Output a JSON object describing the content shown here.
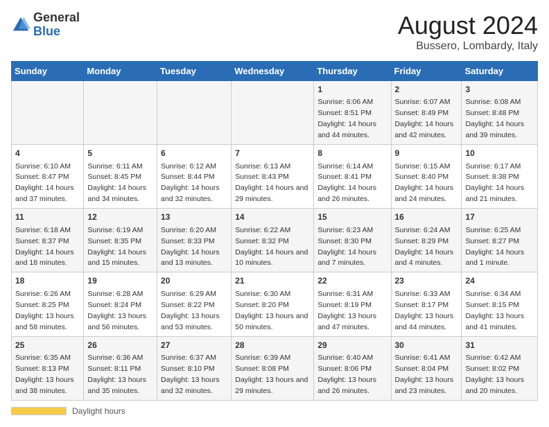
{
  "header": {
    "logo_general": "General",
    "logo_blue": "Blue",
    "main_title": "August 2024",
    "subtitle": "Bussero, Lombardy, Italy"
  },
  "days_of_week": [
    "Sunday",
    "Monday",
    "Tuesday",
    "Wednesday",
    "Thursday",
    "Friday",
    "Saturday"
  ],
  "footer": {
    "daylight_label": "Daylight hours"
  },
  "weeks": [
    [
      {
        "day": "",
        "info": ""
      },
      {
        "day": "",
        "info": ""
      },
      {
        "day": "",
        "info": ""
      },
      {
        "day": "",
        "info": ""
      },
      {
        "day": "1",
        "info": "Sunrise: 6:06 AM\nSunset: 8:51 PM\nDaylight: 14 hours and 44 minutes."
      },
      {
        "day": "2",
        "info": "Sunrise: 6:07 AM\nSunset: 8:49 PM\nDaylight: 14 hours and 42 minutes."
      },
      {
        "day": "3",
        "info": "Sunrise: 6:08 AM\nSunset: 8:48 PM\nDaylight: 14 hours and 39 minutes."
      }
    ],
    [
      {
        "day": "4",
        "info": "Sunrise: 6:10 AM\nSunset: 8:47 PM\nDaylight: 14 hours and 37 minutes."
      },
      {
        "day": "5",
        "info": "Sunrise: 6:11 AM\nSunset: 8:45 PM\nDaylight: 14 hours and 34 minutes."
      },
      {
        "day": "6",
        "info": "Sunrise: 6:12 AM\nSunset: 8:44 PM\nDaylight: 14 hours and 32 minutes."
      },
      {
        "day": "7",
        "info": "Sunrise: 6:13 AM\nSunset: 8:43 PM\nDaylight: 14 hours and 29 minutes."
      },
      {
        "day": "8",
        "info": "Sunrise: 6:14 AM\nSunset: 8:41 PM\nDaylight: 14 hours and 26 minutes."
      },
      {
        "day": "9",
        "info": "Sunrise: 6:15 AM\nSunset: 8:40 PM\nDaylight: 14 hours and 24 minutes."
      },
      {
        "day": "10",
        "info": "Sunrise: 6:17 AM\nSunset: 8:38 PM\nDaylight: 14 hours and 21 minutes."
      }
    ],
    [
      {
        "day": "11",
        "info": "Sunrise: 6:18 AM\nSunset: 8:37 PM\nDaylight: 14 hours and 18 minutes."
      },
      {
        "day": "12",
        "info": "Sunrise: 6:19 AM\nSunset: 8:35 PM\nDaylight: 14 hours and 15 minutes."
      },
      {
        "day": "13",
        "info": "Sunrise: 6:20 AM\nSunset: 8:33 PM\nDaylight: 14 hours and 13 minutes."
      },
      {
        "day": "14",
        "info": "Sunrise: 6:22 AM\nSunset: 8:32 PM\nDaylight: 14 hours and 10 minutes."
      },
      {
        "day": "15",
        "info": "Sunrise: 6:23 AM\nSunset: 8:30 PM\nDaylight: 14 hours and 7 minutes."
      },
      {
        "day": "16",
        "info": "Sunrise: 6:24 AM\nSunset: 8:29 PM\nDaylight: 14 hours and 4 minutes."
      },
      {
        "day": "17",
        "info": "Sunrise: 6:25 AM\nSunset: 8:27 PM\nDaylight: 14 hours and 1 minute."
      }
    ],
    [
      {
        "day": "18",
        "info": "Sunrise: 6:26 AM\nSunset: 8:25 PM\nDaylight: 13 hours and 58 minutes."
      },
      {
        "day": "19",
        "info": "Sunrise: 6:28 AM\nSunset: 8:24 PM\nDaylight: 13 hours and 56 minutes."
      },
      {
        "day": "20",
        "info": "Sunrise: 6:29 AM\nSunset: 8:22 PM\nDaylight: 13 hours and 53 minutes."
      },
      {
        "day": "21",
        "info": "Sunrise: 6:30 AM\nSunset: 8:20 PM\nDaylight: 13 hours and 50 minutes."
      },
      {
        "day": "22",
        "info": "Sunrise: 6:31 AM\nSunset: 8:19 PM\nDaylight: 13 hours and 47 minutes."
      },
      {
        "day": "23",
        "info": "Sunrise: 6:33 AM\nSunset: 8:17 PM\nDaylight: 13 hours and 44 minutes."
      },
      {
        "day": "24",
        "info": "Sunrise: 6:34 AM\nSunset: 8:15 PM\nDaylight: 13 hours and 41 minutes."
      }
    ],
    [
      {
        "day": "25",
        "info": "Sunrise: 6:35 AM\nSunset: 8:13 PM\nDaylight: 13 hours and 38 minutes."
      },
      {
        "day": "26",
        "info": "Sunrise: 6:36 AM\nSunset: 8:11 PM\nDaylight: 13 hours and 35 minutes."
      },
      {
        "day": "27",
        "info": "Sunrise: 6:37 AM\nSunset: 8:10 PM\nDaylight: 13 hours and 32 minutes."
      },
      {
        "day": "28",
        "info": "Sunrise: 6:39 AM\nSunset: 8:08 PM\nDaylight: 13 hours and 29 minutes."
      },
      {
        "day": "29",
        "info": "Sunrise: 6:40 AM\nSunset: 8:06 PM\nDaylight: 13 hours and 26 minutes."
      },
      {
        "day": "30",
        "info": "Sunrise: 6:41 AM\nSunset: 8:04 PM\nDaylight: 13 hours and 23 minutes."
      },
      {
        "day": "31",
        "info": "Sunrise: 6:42 AM\nSunset: 8:02 PM\nDaylight: 13 hours and 20 minutes."
      }
    ]
  ]
}
